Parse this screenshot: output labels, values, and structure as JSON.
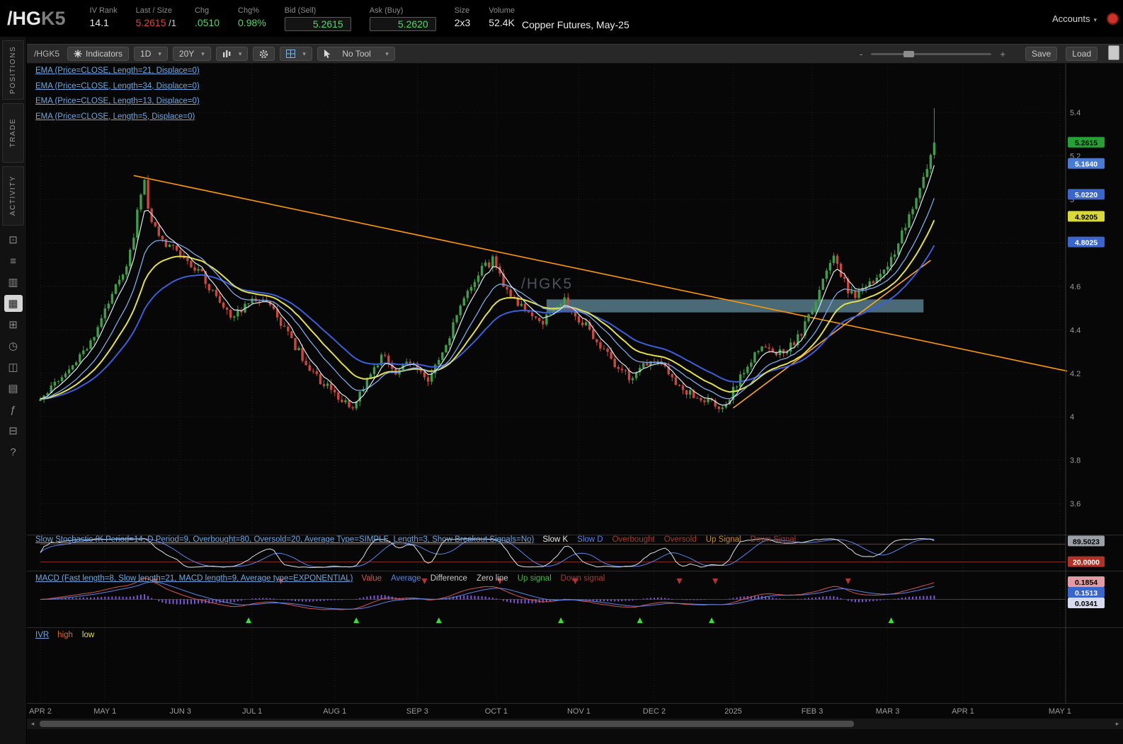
{
  "header": {
    "symbol": "/HG",
    "contract": "K5",
    "description": "Copper Futures, May-25",
    "accounts_label": "Accounts",
    "fields": [
      {
        "id": "iv-rank",
        "label": "IV Rank",
        "value": "14.1",
        "color": "#e8e8e8"
      },
      {
        "id": "last-size",
        "label": "Last / Size",
        "value": "5.2615",
        "suffix": " /1",
        "color": "#e0453c"
      },
      {
        "id": "chg",
        "label": "Chg",
        "value": ".0510",
        "color": "#52d769"
      },
      {
        "id": "chg-pct",
        "label": "Chg%",
        "value": "0.98%",
        "color": "#52d769"
      },
      {
        "id": "bid",
        "label": "Bid (Sell)",
        "value": "5.2615",
        "color": "#52d769",
        "boxed": true
      },
      {
        "id": "ask",
        "label": "Ask (Buy)",
        "value": "5.2620",
        "color": "#52d769",
        "boxed": true
      },
      {
        "id": "size",
        "label": "Size",
        "value": "2x3",
        "color": "#e8e8e8"
      },
      {
        "id": "volume",
        "label": "Volume",
        "value": "52.4K",
        "color": "#e8e8e8"
      }
    ]
  },
  "icons": {
    "chevron_down": "▾",
    "scroll_left": "◂",
    "scroll_right": "▸"
  },
  "sidebar": {
    "tabs": [
      {
        "id": "positions",
        "label": "POSITIONS"
      },
      {
        "id": "trade",
        "label": "TRADE"
      },
      {
        "id": "activity",
        "label": "ACTIVITY"
      }
    ],
    "icons": [
      {
        "id": "monitor",
        "glyph": "⊡"
      },
      {
        "id": "watchlist",
        "glyph": "≡"
      },
      {
        "id": "analyze",
        "glyph": "▥"
      },
      {
        "id": "charts",
        "glyph": "▦",
        "active": true
      },
      {
        "id": "scan",
        "glyph": "⊞"
      },
      {
        "id": "history",
        "glyph": "◷"
      },
      {
        "id": "community",
        "glyph": "◫"
      },
      {
        "id": "calendar",
        "glyph": "▤"
      },
      {
        "id": "fx",
        "glyph": "ƒ"
      },
      {
        "id": "tv",
        "glyph": "⊟"
      },
      {
        "id": "help",
        "glyph": "?"
      }
    ]
  },
  "toolbar": {
    "symbol_label": "/HGK5",
    "indicators_label": "Indicators",
    "timeframe": "1D",
    "range": "20Y",
    "tool_label": "No Tool",
    "save_label": "Save",
    "load_label": "Load",
    "zoom_out": "-",
    "zoom_in": "+"
  },
  "studies": {
    "ema_labels": [
      {
        "text": "EMA (Price=CLOSE, Length=21, Displace=0)",
        "color": "#6fa8e0"
      },
      {
        "text": "EMA (Price=CLOSE, Length=34, Displace=0)",
        "color": "#6fa8e0"
      },
      {
        "text": "EMA (Price=CLOSE, Length=13, Displace=0)",
        "color": "#6fa8e0"
      },
      {
        "text": "EMA (Price=CLOSE, Length=5, Displace=0)",
        "color": "#6fa8e0"
      }
    ]
  },
  "chart_data": {
    "type": "candlestick",
    "symbol": "/HGK5",
    "title": "Copper Futures, May-25",
    "watermark": "/HGK5",
    "timeframe": "1D",
    "range": "20Y",
    "y_axis": {
      "min": 3.46,
      "max": 5.625,
      "ticks": [
        5.4,
        5.2,
        5.0,
        4.8,
        4.6,
        4.4,
        4.2,
        4.0,
        3.8,
        3.6
      ]
    },
    "x_axis": {
      "labels": [
        "APR 2",
        "MAY 1",
        "JUN 3",
        "JUL 1",
        "AUG 1",
        "SEP 3",
        "OCT 1",
        "NOV 1",
        "DEC 2",
        "2025",
        "FEB 3",
        "MAR 3",
        "APR 1",
        "MAY 1"
      ],
      "label_indices": [
        0,
        18,
        39,
        59,
        82,
        105,
        127,
        150,
        171,
        193,
        215,
        236,
        257,
        284
      ]
    },
    "total_candles": 250,
    "noise_seed": 20250318,
    "noise_amp": 0.02,
    "wick_amp": 0.022,
    "last_close": 5.2615,
    "last_high": 5.42,
    "candle_up_color": "#3f9e4a",
    "candle_down_color": "#c8473e",
    "waypoints": [
      [
        0,
        4.08
      ],
      [
        4,
        4.16
      ],
      [
        8,
        4.22
      ],
      [
        12,
        4.3
      ],
      [
        15,
        4.38
      ],
      [
        18,
        4.5
      ],
      [
        21,
        4.62
      ],
      [
        24,
        4.7
      ],
      [
        26,
        4.84
      ],
      [
        28,
        5.04
      ],
      [
        29,
        5.1
      ],
      [
        30,
        4.96
      ],
      [
        32,
        4.86
      ],
      [
        35,
        4.8
      ],
      [
        38,
        4.76
      ],
      [
        41,
        4.71
      ],
      [
        44,
        4.68
      ],
      [
        47,
        4.6
      ],
      [
        50,
        4.52
      ],
      [
        53,
        4.47
      ],
      [
        57,
        4.51
      ],
      [
        60,
        4.55
      ],
      [
        63,
        4.52
      ],
      [
        66,
        4.46
      ],
      [
        69,
        4.38
      ],
      [
        73,
        4.27
      ],
      [
        77,
        4.18
      ],
      [
        81,
        4.12
      ],
      [
        84,
        4.08
      ],
      [
        87,
        4.04
      ],
      [
        90,
        4.14
      ],
      [
        93,
        4.24
      ],
      [
        96,
        4.28
      ],
      [
        99,
        4.21
      ],
      [
        102,
        4.26
      ],
      [
        105,
        4.23
      ],
      [
        108,
        4.18
      ],
      [
        111,
        4.26
      ],
      [
        114,
        4.38
      ],
      [
        117,
        4.5
      ],
      [
        120,
        4.6
      ],
      [
        123,
        4.68
      ],
      [
        126,
        4.72
      ],
      [
        128,
        4.65
      ],
      [
        131,
        4.55
      ],
      [
        134,
        4.5
      ],
      [
        137,
        4.46
      ],
      [
        140,
        4.44
      ],
      [
        143,
        4.5
      ],
      [
        146,
        4.53
      ],
      [
        149,
        4.47
      ],
      [
        152,
        4.42
      ],
      [
        155,
        4.35
      ],
      [
        158,
        4.28
      ],
      [
        161,
        4.22
      ],
      [
        164,
        4.18
      ],
      [
        167,
        4.22
      ],
      [
        170,
        4.27
      ],
      [
        173,
        4.25
      ],
      [
        176,
        4.18
      ],
      [
        179,
        4.13
      ],
      [
        182,
        4.1
      ],
      [
        185,
        4.07
      ],
      [
        188,
        4.05
      ],
      [
        190,
        4.03
      ],
      [
        193,
        4.12
      ],
      [
        196,
        4.22
      ],
      [
        199,
        4.28
      ],
      [
        202,
        4.32
      ],
      [
        205,
        4.29
      ],
      [
        208,
        4.31
      ],
      [
        211,
        4.36
      ],
      [
        214,
        4.46
      ],
      [
        217,
        4.58
      ],
      [
        219,
        4.68
      ],
      [
        221,
        4.76
      ],
      [
        223,
        4.66
      ],
      [
        225,
        4.58
      ],
      [
        227,
        4.55
      ],
      [
        229,
        4.58
      ],
      [
        232,
        4.62
      ],
      [
        235,
        4.68
      ],
      [
        238,
        4.76
      ],
      [
        241,
        4.88
      ],
      [
        243,
        4.97
      ],
      [
        245,
        5.05
      ],
      [
        247,
        5.14
      ],
      [
        249,
        5.2615
      ]
    ],
    "zone": {
      "start_index": 141,
      "end_index": 246,
      "price_top": 4.54,
      "price_bottom": 4.48,
      "color": "#58808f",
      "opacity": 0.82
    },
    "trendlines": [
      {
        "start_index": 26,
        "start_price": 5.11,
        "end_index": 286,
        "end_price": 4.21,
        "color": "#ff9800"
      },
      {
        "start_index": 193,
        "start_price": 4.04,
        "end_index": 248,
        "end_price": 4.72,
        "color": "#ffa826"
      }
    ],
    "emas": [
      {
        "length": 34,
        "color": "#3a5fd9",
        "width": 2
      },
      {
        "length": 21,
        "color": "#e3e04a",
        "width": 2
      },
      {
        "length": 13,
        "color": "#7fa8e8",
        "width": 1.3
      },
      {
        "length": 5,
        "color": "#dde8f2",
        "width": 1.2
      }
    ],
    "price_labels": [
      {
        "text": "5.2615",
        "price": 5.2615,
        "bg": "#27a135",
        "fg": "#000000"
      },
      {
        "text": "5.1640",
        "price": 5.164,
        "bg": "#4a7bd4",
        "fg": "#ffffff"
      },
      {
        "text": "5.0220",
        "price": 5.022,
        "bg": "#3a66cc",
        "fg": "#ffffff"
      },
      {
        "text": "4.9205",
        "price": 4.9205,
        "bg": "#d9d93a",
        "fg": "#000000"
      },
      {
        "text": "4.8025",
        "price": 4.8025,
        "bg": "#3a66cc",
        "fg": "#ffffff"
      }
    ],
    "stochastic": {
      "label": "Slow Stochastic (K Period=14, D Period=9, Overbought=80, Oversold=20, Average Type=SIMPLE, Length=3, Show Breakout Signals=No)",
      "legend": [
        {
          "text": "Slow K",
          "color": "#e8e8e8"
        },
        {
          "text": "Slow D",
          "color": "#5b84e8"
        },
        {
          "text": "Overbought",
          "color": "#a63b30"
        },
        {
          "text": "Oversold",
          "color": "#a63b30"
        },
        {
          "text": "Up Signal",
          "color": "#c98a2c"
        },
        {
          "text": "Down Signal",
          "color": "#a63b30"
        }
      ],
      "overbought": 80,
      "oversold": 20,
      "k_color": "#dfe5ea",
      "d_color": "#5b84e8",
      "band_color": "#8b2f26",
      "value_boxes": [
        {
          "text": "89.5023",
          "value": 89.5,
          "bg": "#9aa2a8",
          "fg": "#000000"
        },
        {
          "text": "20.0000",
          "value": 20,
          "bg": "#b13328",
          "fg": "#ffffff"
        }
      ]
    },
    "macd": {
      "label": "MACD (Fast length=8, Slow length=21, MACD length=9, Average type=EXPONENTIAL)",
      "legend": [
        {
          "text": "Value",
          "color": "#d9534f"
        },
        {
          "text": "Average",
          "color": "#5b84e8"
        },
        {
          "text": "Difference",
          "color": "#cccccc"
        },
        {
          "text": "Zero line",
          "color": "#cccccc"
        },
        {
          "text": "Up signal",
          "color": "#44b549"
        },
        {
          "text": "Down signal",
          "color": "#a63b30"
        }
      ],
      "fast": 8,
      "slow": 21,
      "signal": 9,
      "value_color": "#d9534f",
      "average_color": "#5b84e8",
      "hist_color": "#7d55d8",
      "zero_color": "#6e2f2a",
      "up_arrow_color": "#3ddc3d",
      "down_arrow_color": "#b03535",
      "value_boxes": [
        {
          "text": "0.1854",
          "bg": "#e49aa2",
          "fg": "#000000"
        },
        {
          "text": "0.1513",
          "bg": "#3a66cc",
          "fg": "#ffffff"
        },
        {
          "text": "0.0341",
          "bg": "#d8dbee",
          "fg": "#000000"
        }
      ]
    },
    "ivr": {
      "label": "IVR",
      "legend": [
        {
          "text": "high",
          "color": "#d96a35"
        },
        {
          "text": "low",
          "color": "#e3e04a"
        }
      ]
    }
  }
}
